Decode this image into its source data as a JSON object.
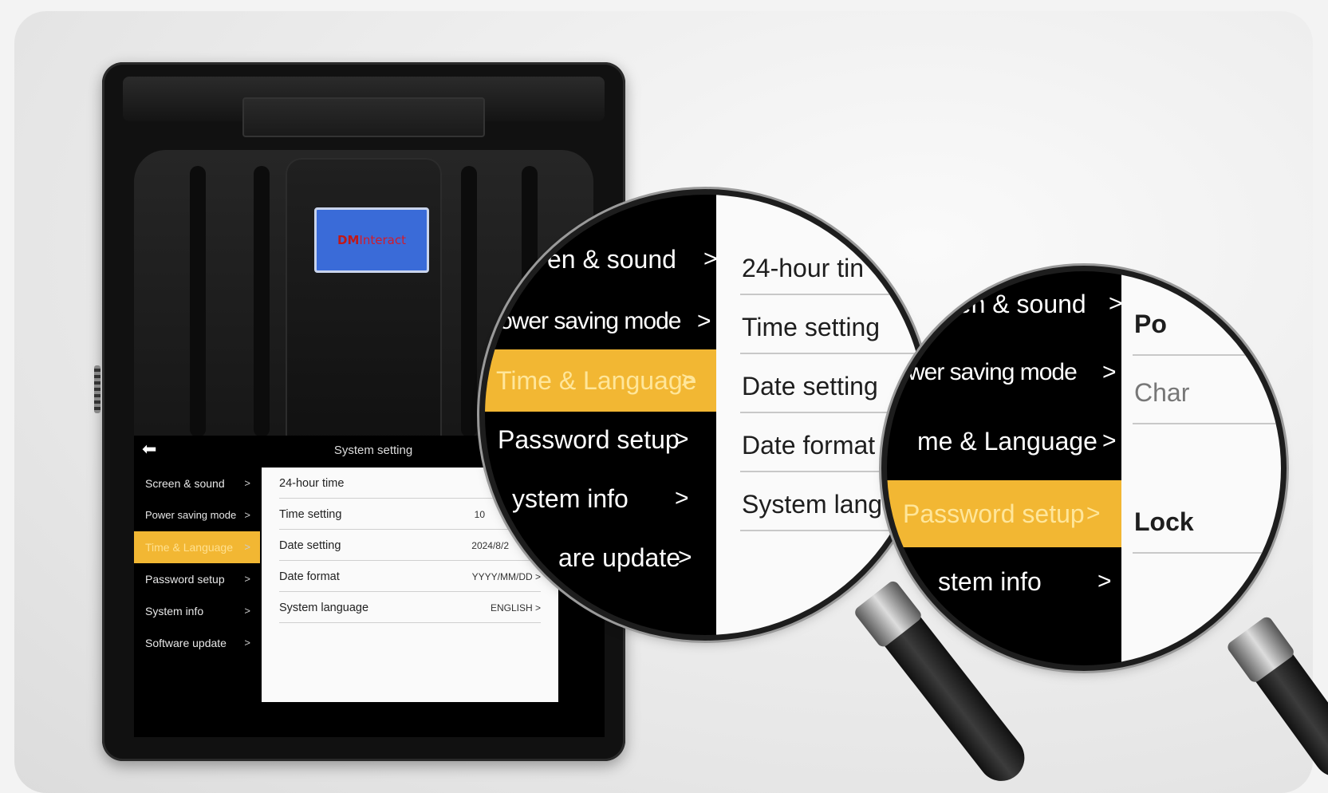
{
  "device": {
    "logo_dm": "DM",
    "logo_rest": "Interact"
  },
  "screen": {
    "title": "System setting",
    "menu": [
      {
        "label": "Screen & sound",
        "active": false
      },
      {
        "label": "Power saving mode",
        "active": false
      },
      {
        "label": "Time & Language",
        "active": true
      },
      {
        "label": "Password setup",
        "active": false
      },
      {
        "label": "System info",
        "active": false
      },
      {
        "label": "Software update",
        "active": false
      }
    ],
    "settings": [
      {
        "label": "24-hour time",
        "value": ""
      },
      {
        "label": "Time setting",
        "value": "10"
      },
      {
        "label": "Date setting",
        "value": "2024/8/2"
      },
      {
        "label": "Date format",
        "value": "YYYY/MM/DD >"
      },
      {
        "label": "System language",
        "value": "ENGLISH >"
      }
    ]
  },
  "lens1": {
    "menu": [
      {
        "label": "en & sound"
      },
      {
        "label": "ower saving mode"
      },
      {
        "label": "Time & Language"
      },
      {
        "label": "Password setup"
      },
      {
        "label": "ystem info"
      },
      {
        "label": "are update"
      }
    ],
    "settings": [
      "24-hour tin",
      "Time setting",
      "Date setting",
      "Date format",
      "System lang"
    ]
  },
  "lens2": {
    "menu": [
      {
        "label": "een & sound"
      },
      {
        "label": "wer saving mode"
      },
      {
        "label": "me & Language"
      },
      {
        "label": "Password setup"
      },
      {
        "label": "stem info"
      }
    ],
    "settings": [
      "Po",
      "Char",
      "Lock"
    ]
  },
  "icons": {
    "back": "back-arrow-icon",
    "chevron": "chevron-right-icon"
  },
  "colors": {
    "accent": "#f2b733",
    "screen_bg": "#000000",
    "panel_bg": "#fafafa",
    "lcd": "#3a6bd8"
  }
}
